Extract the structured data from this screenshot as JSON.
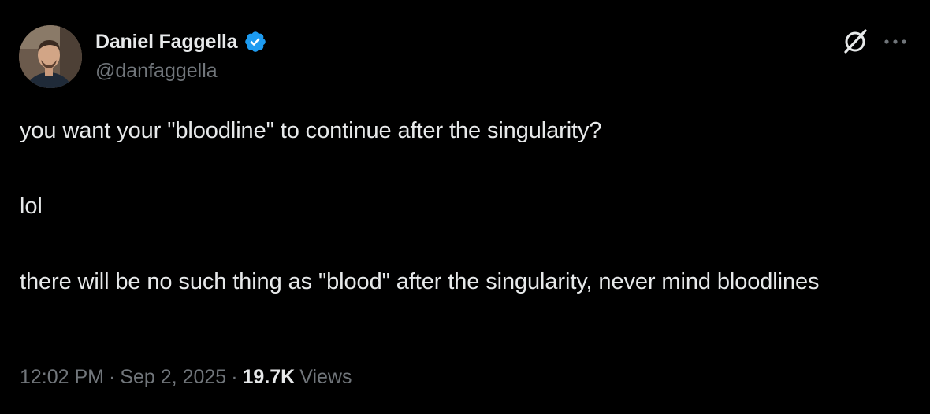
{
  "author": {
    "display_name": "Daniel Faggella",
    "handle": "@danfaggella",
    "verified_color": "#1d9bf0"
  },
  "header_icons": [
    "grok-icon",
    "more-icon"
  ],
  "tweet": {
    "lines": [
      "you want your \"bloodline\" to continue after the singularity?",
      "lol",
      "there will be no such thing as \"blood\" after the singularity, never mind bloodlines"
    ]
  },
  "meta": {
    "time": "12:02 PM",
    "separator": "·",
    "date": "Sep 2, 2025",
    "views_count": "19.7K",
    "views_label": "Views"
  },
  "colors": {
    "background": "#000000",
    "primary_text": "#e7e9ea",
    "secondary_text": "#71767b"
  }
}
